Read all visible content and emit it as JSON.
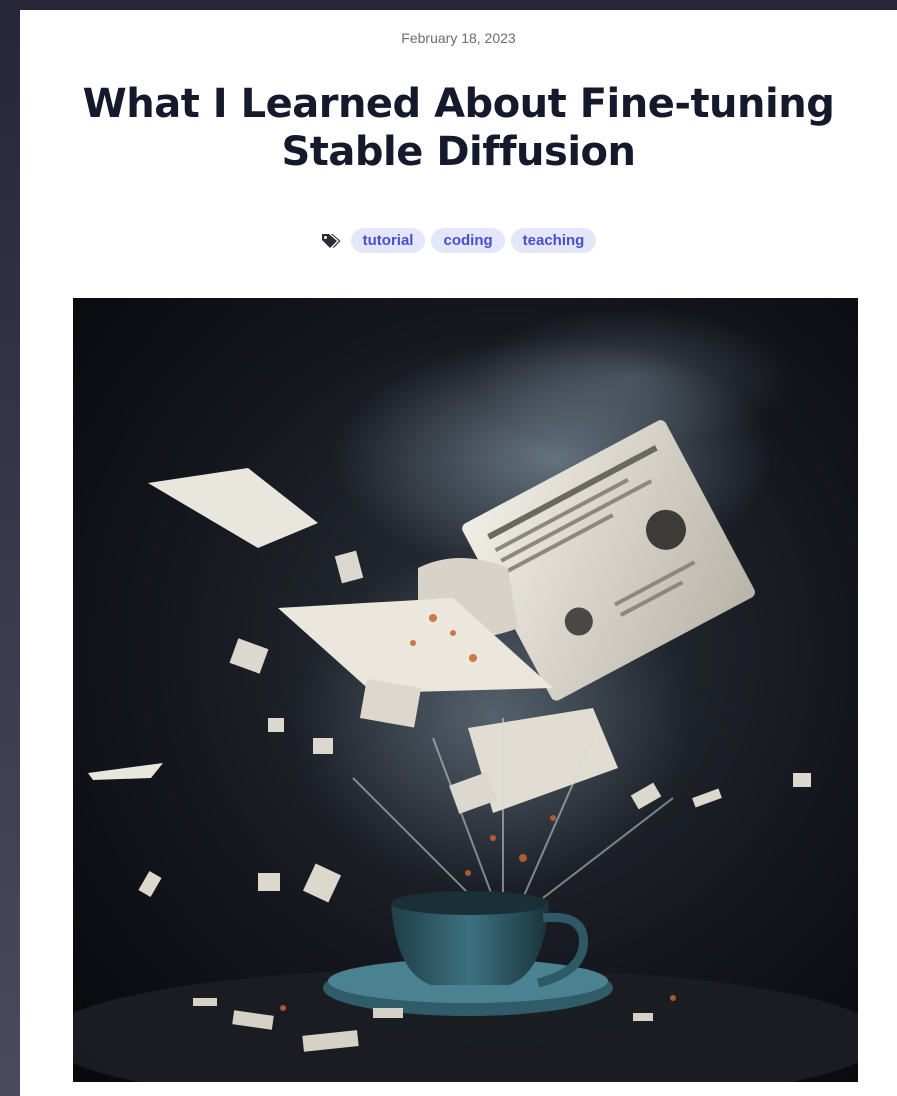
{
  "post": {
    "date": "February 18, 2023",
    "title": "What I Learned About Fine-tuning Stable Diffusion",
    "tags": [
      "tutorial",
      "coding",
      "teaching"
    ],
    "tags_icon": "tags-icon",
    "hero_image": "newspaper-exploding-from-teacup-image"
  },
  "colors": {
    "tag_bg": "#e4e6fb",
    "tag_text": "#4a4dcf",
    "title_text": "#141a2c",
    "date_text": "#6b6b78"
  }
}
